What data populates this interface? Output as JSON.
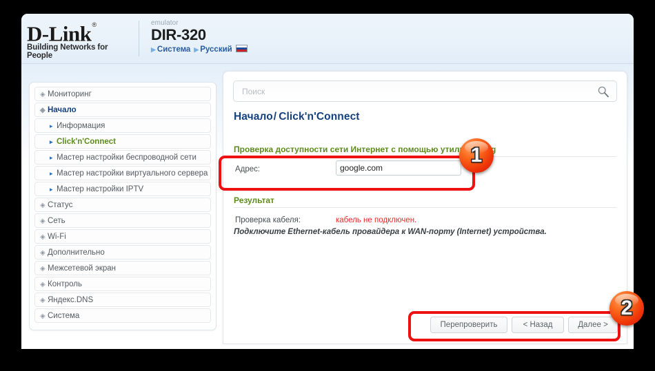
{
  "header": {
    "brand_name": "D-Link",
    "brand_reg": "®",
    "brand_tagline": "Building Networks for People",
    "emulator_label": "emulator",
    "model": "DIR-320",
    "link_system": "Система",
    "link_language": "Русский",
    "flag_icon": "russian-flag-icon"
  },
  "sidebar": {
    "items": [
      {
        "label": "Мониторинг",
        "level": "top",
        "state": "normal",
        "icon": "chevron-circle-icon"
      },
      {
        "label": "Начало",
        "level": "top",
        "state": "open",
        "icon": "chevron-circle-icon"
      },
      {
        "label": "Информация",
        "level": "sub",
        "state": "normal",
        "icon": "arrow-right-icon"
      },
      {
        "label": "Click'n'Connect",
        "level": "sub",
        "state": "selected",
        "icon": "arrow-right-icon"
      },
      {
        "label": "Мастер настройки беспроводной сети",
        "level": "sub",
        "state": "normal",
        "icon": "arrow-right-icon"
      },
      {
        "label": "Мастер настройки виртуального сервера",
        "level": "sub",
        "state": "normal",
        "icon": "arrow-right-icon"
      },
      {
        "label": "Мастер настройки IPTV",
        "level": "sub",
        "state": "normal",
        "icon": "arrow-right-icon"
      },
      {
        "label": "Статус",
        "level": "top",
        "state": "normal",
        "icon": "chevron-circle-icon"
      },
      {
        "label": "Сеть",
        "level": "top",
        "state": "normal",
        "icon": "chevron-circle-icon"
      },
      {
        "label": "Wi-Fi",
        "level": "top",
        "state": "normal",
        "icon": "chevron-circle-icon"
      },
      {
        "label": "Дополнительно",
        "level": "top",
        "state": "normal",
        "icon": "chevron-circle-icon"
      },
      {
        "label": "Межсетевой экран",
        "level": "top",
        "state": "normal",
        "icon": "chevron-circle-icon"
      },
      {
        "label": "Контроль",
        "level": "top",
        "state": "normal",
        "icon": "chevron-circle-icon"
      },
      {
        "label": "Яндекс.DNS",
        "level": "top",
        "state": "normal",
        "icon": "chevron-circle-icon"
      },
      {
        "label": "Система",
        "level": "top",
        "state": "normal",
        "icon": "chevron-circle-icon"
      }
    ]
  },
  "search": {
    "placeholder": "Поиск",
    "value": "",
    "icon": "search-icon"
  },
  "main": {
    "breadcrumb_root": "Начало",
    "breadcrumb_sep": "/",
    "breadcrumb_current": "Click'n'Connect",
    "ping_section_title": "Проверка доступности сети Интернет с помощью утилиты Ping",
    "address_label": "Адрес:",
    "address_value": "google.com",
    "result_section_title": "Результат",
    "cable_label": "Проверка кабеля:",
    "cable_value": "кабель не подключен.",
    "cable_value_color": "#ec2a2a",
    "hint": "Подключите Ethernet-кабель провайдера к WAN-порту (Internet) устройства."
  },
  "buttons": {
    "recheck": "Перепроверить",
    "back": "< Назад",
    "next": "Далее >"
  },
  "annotations": {
    "badge_one": "1",
    "badge_two": "2",
    "highlight_color": "#ee1111"
  }
}
